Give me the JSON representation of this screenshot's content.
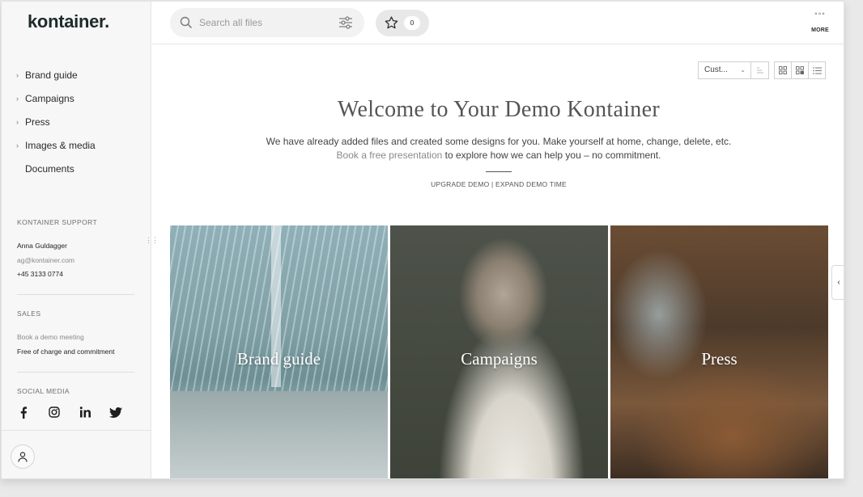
{
  "brand": {
    "logo": "kontainer."
  },
  "nav": {
    "items": [
      {
        "label": "Brand guide",
        "expandable": true
      },
      {
        "label": "Campaigns",
        "expandable": true
      },
      {
        "label": "Press",
        "expandable": true
      },
      {
        "label": "Images & media",
        "expandable": true
      },
      {
        "label": "Documents",
        "expandable": false
      }
    ]
  },
  "support": {
    "title": "KONTAINER SUPPORT",
    "name": "Anna Guldagger",
    "email": "ag@kontainer.com",
    "phone": "+45 3133 0774"
  },
  "sales": {
    "title": "SALES",
    "line1": "Book a demo meeting",
    "line2": "Free of charge and commitment"
  },
  "social": {
    "title": "SOCIAL MEDIA",
    "icons": [
      "facebook-icon",
      "instagram-icon",
      "linkedin-icon",
      "twitter-icon"
    ]
  },
  "topbar": {
    "search_placeholder": "Search all files",
    "favorites_count": "0",
    "more_label": "MORE"
  },
  "controls": {
    "sort_value": "Cust...",
    "views": [
      "grid-large-icon",
      "grid-small-icon",
      "list-icon"
    ]
  },
  "welcome": {
    "title": "Welcome to Your Demo Kontainer",
    "line1": "We have already added files and created some designs for you. Make yourself at home, change, delete, etc.",
    "line2_muted": "Book a free presentation",
    "line2_rest": " to explore how we can help you – no commitment.",
    "link_upgrade": "UPGRADE DEMO",
    "link_sep": " | ",
    "link_expand": "EXPAND DEMO TIME"
  },
  "tiles": [
    {
      "label": "Brand guide"
    },
    {
      "label": "Campaigns"
    },
    {
      "label": "Press"
    }
  ],
  "colors": {
    "sidebar_bg": "#f6f7f6",
    "search_bg": "#f1f2f1",
    "text": "#2b2b2b",
    "muted": "#8a8a8a"
  }
}
